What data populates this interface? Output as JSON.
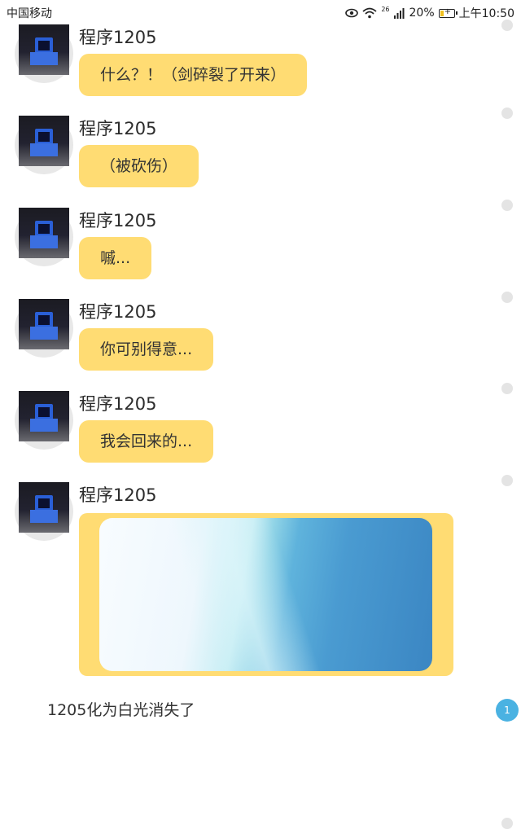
{
  "status_bar": {
    "carrier": "中国移动",
    "network": "26",
    "battery": "20%",
    "time": "上午10:50",
    "icons": [
      "eye-icon",
      "wifi-icon",
      "signal-icon",
      "battery-icon"
    ]
  },
  "messages": [
    {
      "sender": "程序1205",
      "text": "什么？！（剑碎裂了开来）"
    },
    {
      "sender": "程序1205",
      "text": "（被砍伤）"
    },
    {
      "sender": "程序1205",
      "text": "嘁..."
    },
    {
      "sender": "程序1205",
      "text": "你可别得意..."
    },
    {
      "sender": "程序1205",
      "text": "我会回来的..."
    },
    {
      "sender": "程序1205",
      "image": "sky-photo"
    }
  ],
  "system_message": "1205化为白光消失了",
  "unread_badge": "1",
  "colors": {
    "bubble": "#ffdc73",
    "badge": "#4ab2e2",
    "background": "#ffffff"
  }
}
